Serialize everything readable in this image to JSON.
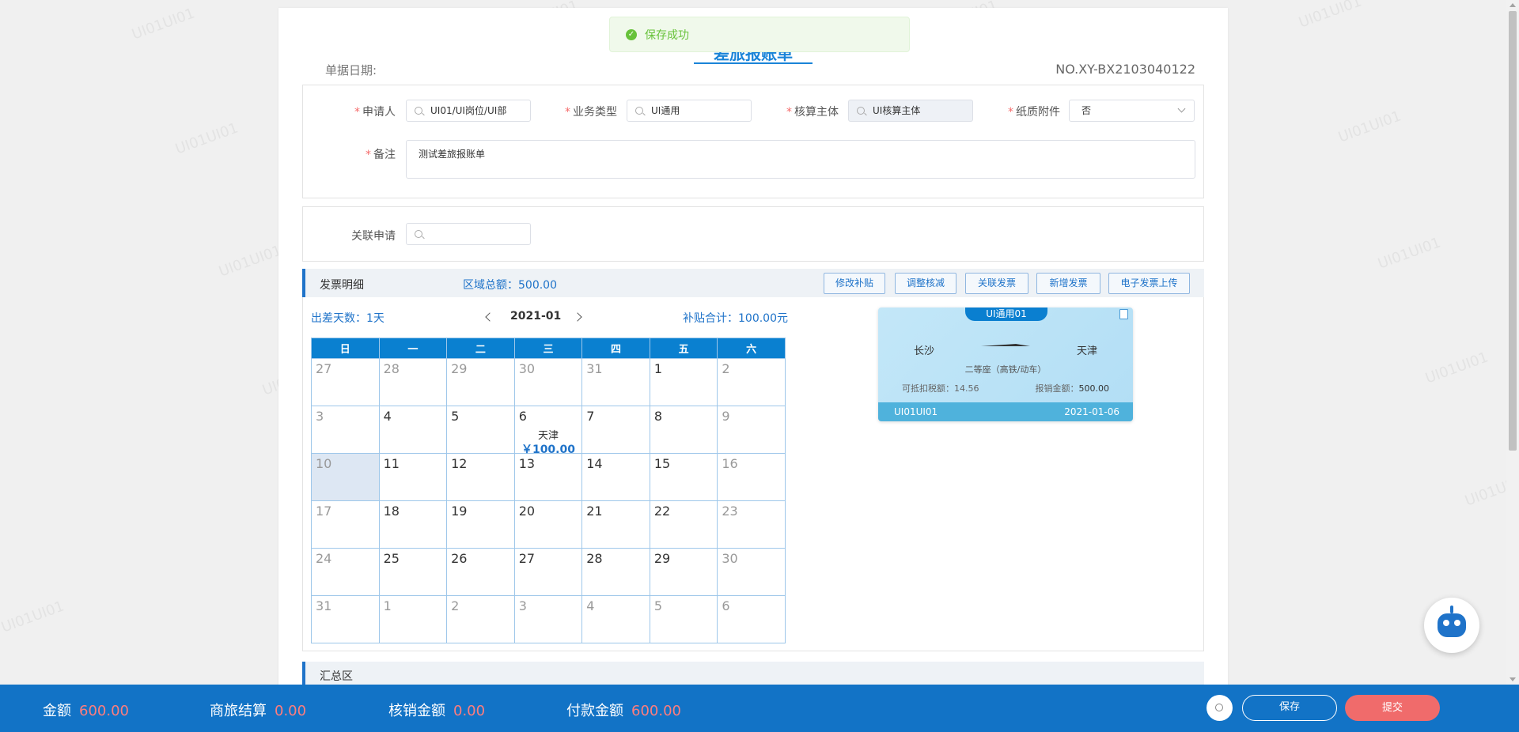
{
  "watermark": "UI01UI01",
  "toast": {
    "message": "保存成功"
  },
  "doc": {
    "title": "差旅报账单",
    "date_label": "单据日期:",
    "number": "NO.XY-BX2103040122"
  },
  "form": {
    "applicant": {
      "label": "申请人",
      "value": "UI01/UI岗位/UI部"
    },
    "biz_type": {
      "label": "业务类型",
      "value": "UI通用"
    },
    "accounting": {
      "label": "核算主体",
      "value": "UI核算主体"
    },
    "paper_attach": {
      "label": "纸质附件",
      "value": "否"
    },
    "remark": {
      "label": "备注",
      "value": "测试差旅报账单"
    },
    "related": {
      "label": "关联申请",
      "value": ""
    }
  },
  "invoice": {
    "section_title": "发票明细",
    "area_total": "区域总额：500.00",
    "buttons": [
      "修改补贴",
      "调整核减",
      "关联发票",
      "新增发票",
      "电子发票上传"
    ]
  },
  "calendar": {
    "trip_days": "出差天数：1天",
    "month": "2021-01",
    "subsidy_total": "补贴合计：100.00元",
    "weekdays": [
      "日",
      "一",
      "二",
      "三",
      "四",
      "五",
      "六"
    ],
    "weeks": [
      [
        {
          "d": "27",
          "o": true
        },
        {
          "d": "28",
          "o": true
        },
        {
          "d": "29",
          "o": true
        },
        {
          "d": "30",
          "o": true
        },
        {
          "d": "31",
          "o": true
        },
        {
          "d": "1"
        },
        {
          "d": "2",
          "o": true
        }
      ],
      [
        {
          "d": "3",
          "o": true
        },
        {
          "d": "4"
        },
        {
          "d": "5"
        },
        {
          "d": "6",
          "city": "天津",
          "amount": "￥100.00"
        },
        {
          "d": "7"
        },
        {
          "d": "8"
        },
        {
          "d": "9",
          "o": true
        }
      ],
      [
        {
          "d": "10",
          "today": true
        },
        {
          "d": "11"
        },
        {
          "d": "12"
        },
        {
          "d": "13"
        },
        {
          "d": "14"
        },
        {
          "d": "15"
        },
        {
          "d": "16",
          "o": true
        }
      ],
      [
        {
          "d": "17",
          "o": true
        },
        {
          "d": "18"
        },
        {
          "d": "19"
        },
        {
          "d": "20"
        },
        {
          "d": "21"
        },
        {
          "d": "22"
        },
        {
          "d": "23",
          "o": true
        }
      ],
      [
        {
          "d": "24",
          "o": true
        },
        {
          "d": "25"
        },
        {
          "d": "26"
        },
        {
          "d": "27"
        },
        {
          "d": "28"
        },
        {
          "d": "29"
        },
        {
          "d": "30",
          "o": true
        }
      ],
      [
        {
          "d": "31",
          "o": true
        },
        {
          "d": "1",
          "o": true
        },
        {
          "d": "2",
          "o": true
        },
        {
          "d": "3",
          "o": true
        },
        {
          "d": "4",
          "o": true
        },
        {
          "d": "5",
          "o": true
        },
        {
          "d": "6",
          "o": true
        }
      ]
    ]
  },
  "ticket": {
    "tag": "UI通用01",
    "from": "长沙",
    "to": "天津",
    "seat": "二等座（高铁/动车）",
    "tax_label": "可抵扣税额：14.56",
    "reimb_label": "报销金额：",
    "reimb_value": "500.00",
    "person": "UI01UI01",
    "date": "2021-01-06"
  },
  "summary": {
    "title": "汇总区"
  },
  "bottom": {
    "amount_label": "金额",
    "amount": "600.00",
    "travel_label": "商旅结算",
    "travel": "0.00",
    "writeoff_label": "核销金额",
    "writeoff": "0.00",
    "pay_label": "付款金额",
    "pay": "600.00",
    "save": "保存",
    "submit": "提交"
  }
}
